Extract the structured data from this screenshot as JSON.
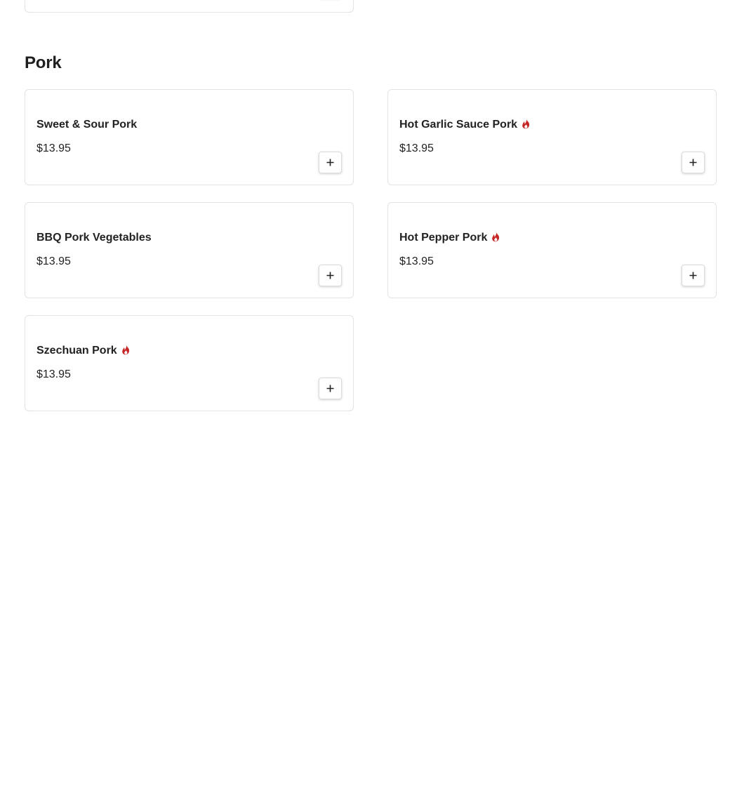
{
  "section": {
    "title": "Pork"
  },
  "items": [
    {
      "name": "Sweet & Sour Pork",
      "price": "$13.95",
      "spicy": false
    },
    {
      "name": "Hot Garlic Sauce Pork",
      "price": "$13.95",
      "spicy": true
    },
    {
      "name": "BBQ Pork Vegetables",
      "price": "$13.95",
      "spicy": false
    },
    {
      "name": "Hot Pepper Pork",
      "price": "$13.95",
      "spicy": true
    },
    {
      "name": "Szechuan Pork",
      "price": "$13.95",
      "spicy": true
    }
  ],
  "icons": {
    "spicy": "flame-icon",
    "add": "plus-icon"
  },
  "colors": {
    "spicy": "#c62828",
    "text": "#222222",
    "border": "#e3e3e3"
  }
}
